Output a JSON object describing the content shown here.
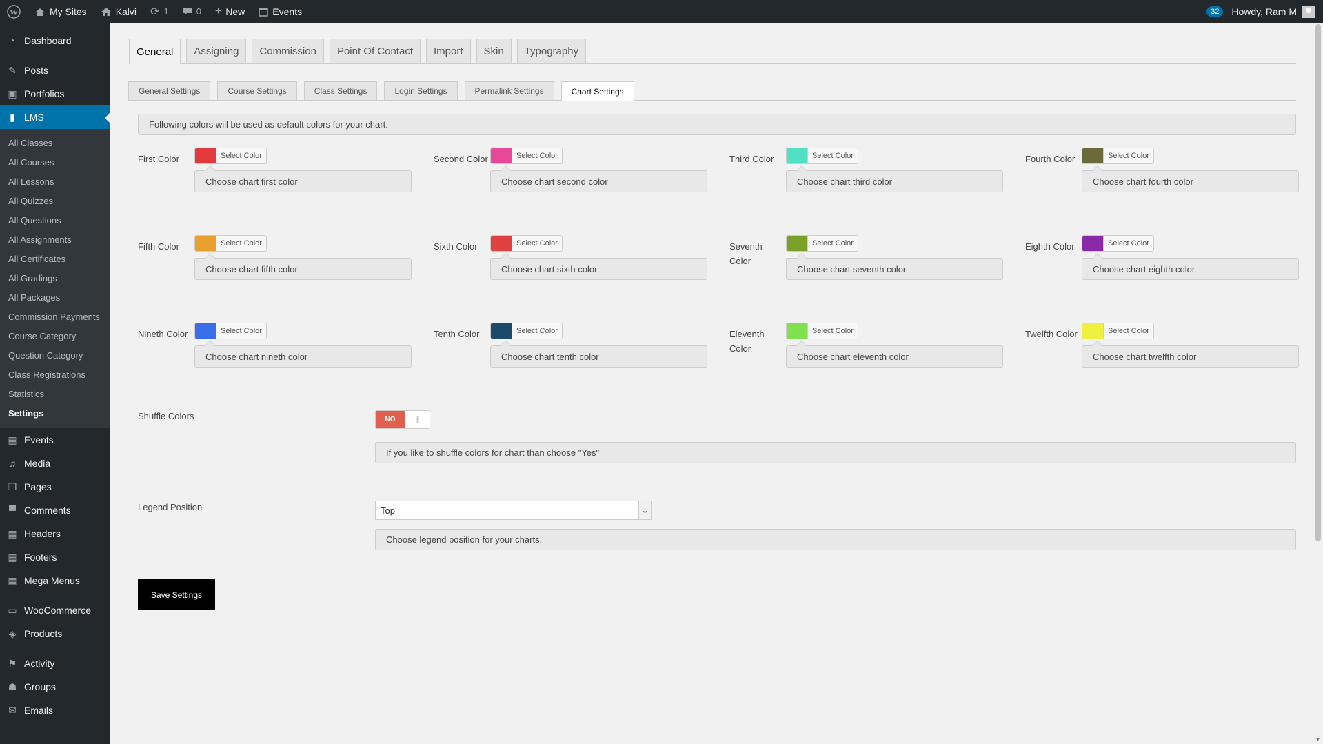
{
  "adminbar": {
    "my_sites": "My Sites",
    "site_name": "Kalvi",
    "updates_count": "1",
    "comments_count": "0",
    "new_label": "New",
    "events_label": "Events",
    "notifications_count": "32",
    "howdy": "Howdy, Ram M"
  },
  "sidebar": {
    "dashboard": "Dashboard",
    "posts": "Posts",
    "portfolios": "Portfolios",
    "lms": "LMS",
    "lms_sub": [
      "All Classes",
      "All Courses",
      "All Lessons",
      "All Quizzes",
      "All Questions",
      "All Assignments",
      "All Certificates",
      "All Gradings",
      "All Packages",
      "Commission Payments",
      "Course Category",
      "Question Category",
      "Class Registrations",
      "Statistics",
      "Settings"
    ],
    "events": "Events",
    "media": "Media",
    "pages": "Pages",
    "comments": "Comments",
    "headers": "Headers",
    "footers": "Footers",
    "mega_menus": "Mega Menus",
    "woocommerce": "WooCommerce",
    "products": "Products",
    "activity": "Activity",
    "groups": "Groups",
    "emails": "Emails"
  },
  "tabs": [
    "General",
    "Assigning",
    "Commission",
    "Point Of Contact",
    "Import",
    "Skin",
    "Typography"
  ],
  "subtabs": [
    "General Settings",
    "Course Settings",
    "Class Settings",
    "Login Settings",
    "Permalink Settings",
    "Chart Settings"
  ],
  "intro": "Following colors will be used as default colors for your chart.",
  "select_color_label": "Select Color",
  "colors": [
    {
      "label": "First Color",
      "hex": "#e03a3a",
      "desc": "Choose chart first color"
    },
    {
      "label": "Second Color",
      "hex": "#e8489a",
      "desc": "Choose chart second color"
    },
    {
      "label": "Third Color",
      "hex": "#52e0c4",
      "desc": "Choose chart third color"
    },
    {
      "label": "Fourth Color",
      "hex": "#6b6a3a",
      "desc": "Choose chart fourth color"
    },
    {
      "label": "Fifth Color",
      "hex": "#e8a030",
      "desc": "Choose chart fifth color"
    },
    {
      "label": "Sixth Color",
      "hex": "#e04040",
      "desc": "Choose chart sixth color"
    },
    {
      "label": "Seventh Color",
      "hex": "#7aa02a",
      "desc": "Choose chart seventh color"
    },
    {
      "label": "Eighth Color",
      "hex": "#8a2aa8",
      "desc": "Choose chart eighth color"
    },
    {
      "label": "Nineth Color",
      "hex": "#3a6ee8",
      "desc": "Choose chart nineth color"
    },
    {
      "label": "Tenth Color",
      "hex": "#1e4a6a",
      "desc": "Choose chart tenth color"
    },
    {
      "label": "Eleventh Color",
      "hex": "#80e050",
      "desc": "Choose chart eleventh color"
    },
    {
      "label": "Twelfth Color",
      "hex": "#f0f040",
      "desc": "Choose chart twelfth color"
    }
  ],
  "shuffle": {
    "label": "Shuffle Colors",
    "toggle_value": "NO",
    "desc": "If you like to shuffle colors for chart than choose \"Yes\""
  },
  "legend": {
    "label": "Legend Position",
    "value": "Top",
    "desc": "Choose legend position for your charts."
  },
  "save_label": "Save Settings"
}
